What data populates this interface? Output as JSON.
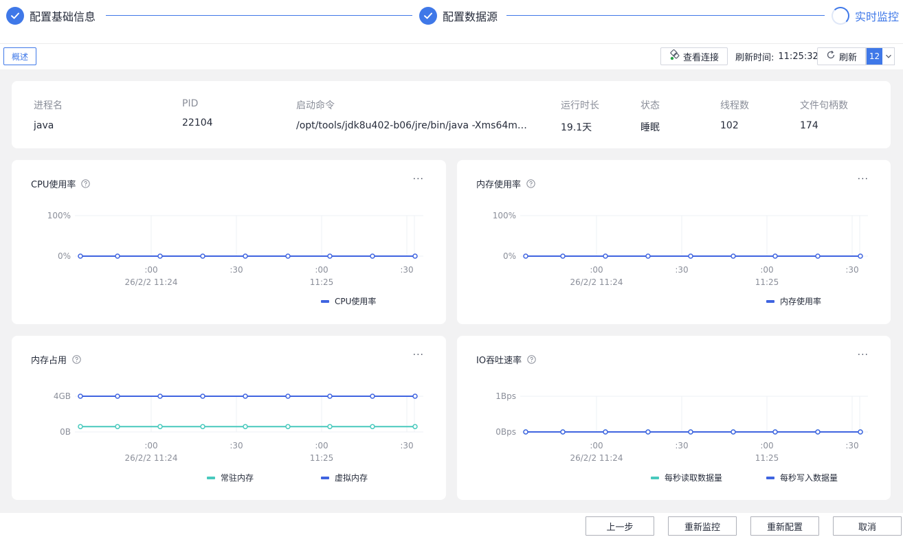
{
  "stepper": {
    "steps": [
      {
        "label": "配置基础信息",
        "state": "done"
      },
      {
        "label": "配置数据源",
        "state": "done"
      },
      {
        "label": "实时监控",
        "state": "active"
      }
    ]
  },
  "toolbar": {
    "overview_tab": "概述",
    "view_connection": "查看连接",
    "refresh_time_label": "刷新时间:",
    "refresh_time_value": "11:25:32",
    "refresh_button": "刷新",
    "refresh_interval": "12"
  },
  "process": {
    "headers": [
      "进程名",
      "PID",
      "启动命令",
      "运行时长",
      "状态",
      "线程数",
      "文件句柄数"
    ],
    "values": [
      "java",
      "22104",
      "/opt/tools/jdk8u402-b06/jre/bin/java -Xms64m -...",
      "19.1天",
      "睡眠",
      "102",
      "174"
    ]
  },
  "colors": {
    "accent": "#3f78e8",
    "series_blue": "#3f64e0",
    "series_teal": "#48c9bd",
    "grid": "#eef0f5"
  },
  "icons": {
    "step_done": "check-circle-icon",
    "step_active": "loading-spinner-icon",
    "view_connection": "connection-icon",
    "refresh": "refresh-icon",
    "interval_dropdown": "chevron-down-icon",
    "chart_help": "question-circle-icon",
    "chart_more": "more-icon"
  },
  "chart_data": [
    {
      "type": "line",
      "title": "CPU使用率",
      "menu": "···",
      "yticks": [
        "100%",
        "0%"
      ],
      "ylim": [
        0,
        100
      ],
      "x_ticks": [
        ":00",
        ":30",
        ":00",
        ":30"
      ],
      "x_sub_ticks": [
        "26/2/2 11:24",
        "",
        "11:25",
        ""
      ],
      "series": [
        {
          "name": "CPU使用率",
          "color": "#3f64e0",
          "values": [
            0,
            0,
            0,
            0,
            0,
            0,
            0,
            0,
            0
          ]
        }
      ]
    },
    {
      "type": "line",
      "title": "内存使用率",
      "menu": "···",
      "yticks": [
        "100%",
        "0%"
      ],
      "ylim": [
        0,
        100
      ],
      "x_ticks": [
        ":00",
        ":30",
        ":00",
        ":30"
      ],
      "x_sub_ticks": [
        "26/2/2 11:24",
        "",
        "11:25",
        ""
      ],
      "series": [
        {
          "name": "内存使用率",
          "color": "#3f64e0",
          "values": [
            0,
            0,
            0,
            0,
            0,
            0,
            0,
            0,
            0
          ]
        }
      ]
    },
    {
      "type": "line",
      "title": "内存占用",
      "menu": "···",
      "yticks": [
        "4GB",
        "0B"
      ],
      "ylim": [
        0,
        4
      ],
      "x_ticks": [
        ":00",
        ":30",
        ":00",
        ":30"
      ],
      "x_sub_ticks": [
        "26/2/2 11:24",
        "",
        "11:25",
        ""
      ],
      "series": [
        {
          "name": "常驻内存",
          "color": "#48c9bd",
          "values": [
            0.6,
            0.6,
            0.6,
            0.6,
            0.6,
            0.6,
            0.6,
            0.6,
            0.6
          ]
        },
        {
          "name": "虚拟内存",
          "color": "#3f64e0",
          "values": [
            4,
            4,
            4,
            4,
            4,
            4,
            4,
            4,
            4
          ]
        }
      ]
    },
    {
      "type": "line",
      "title": "IO吞吐速率",
      "menu": "···",
      "yticks": [
        "1Bps",
        "0Bps"
      ],
      "ylim": [
        0,
        1
      ],
      "x_ticks": [
        ":00",
        ":30",
        ":00",
        ":30"
      ],
      "x_sub_ticks": [
        "26/2/2 11:24",
        "",
        "11:25",
        ""
      ],
      "series": [
        {
          "name": "每秒读取数据量",
          "color": "#48c9bd",
          "values": [
            0,
            0,
            0,
            0,
            0,
            0,
            0,
            0,
            0
          ]
        },
        {
          "name": "每秒写入数据量",
          "color": "#3f64e0",
          "values": [
            0,
            0,
            0,
            0,
            0,
            0,
            0,
            0,
            0
          ]
        }
      ]
    }
  ],
  "footer": {
    "prev": "上一步",
    "restart_monitor": "重新监控",
    "reconfigure": "重新配置",
    "cancel": "取消"
  }
}
